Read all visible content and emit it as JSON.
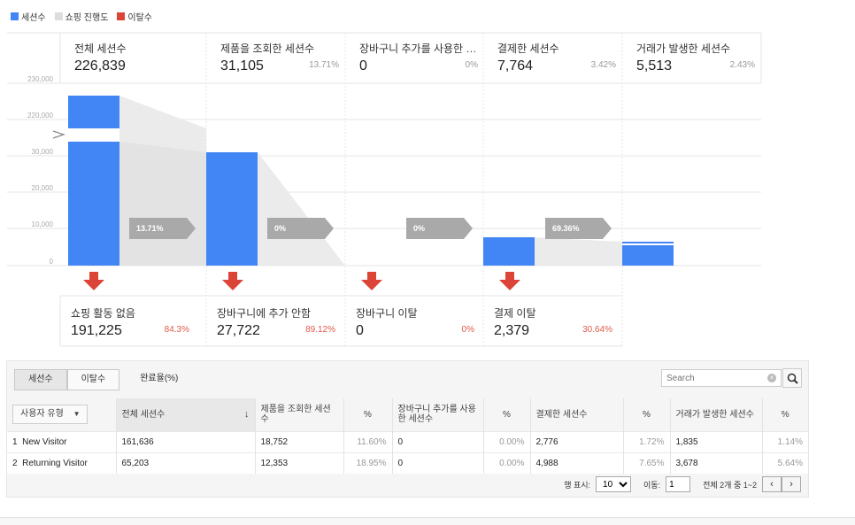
{
  "legend": [
    {
      "label": "세션수",
      "color": "#4285f4"
    },
    {
      "label": "쇼핑 진행도",
      "color": "#dddddd"
    },
    {
      "label": "이탈수",
      "color": "#db4437"
    }
  ],
  "y_ticks": [
    "230,000",
    "220,000",
    "30,000",
    "20,000",
    "10,000",
    "0"
  ],
  "stages": [
    {
      "label": "전체 세션수",
      "value": "226,839",
      "pct": "",
      "progress": "13.71%",
      "drop_label": "쇼핑 활동 없음",
      "drop_value": "191,225",
      "drop_pct": "84.3%"
    },
    {
      "label": "제품을 조회한 세션수",
      "value": "31,105",
      "pct": "13.71%",
      "progress": "0%",
      "drop_label": "장바구니에 추가 안함",
      "drop_value": "27,722",
      "drop_pct": "89.12%"
    },
    {
      "label": "장바구니 추가를 사용한 세...",
      "value": "0",
      "pct": "0%",
      "progress": "0%",
      "drop_label": "장바구니 이탈",
      "drop_value": "0",
      "drop_pct": "0%"
    },
    {
      "label": "결제한 세션수",
      "value": "7,764",
      "pct": "3.42%",
      "progress": "69.36%",
      "drop_label": "결제 이탈",
      "drop_value": "2,379",
      "drop_pct": "30.64%"
    },
    {
      "label": "거래가 발생한 세션수",
      "value": "5,513",
      "pct": "2.43%"
    }
  ],
  "tabs": {
    "sessions": "세선수",
    "exits": "이탈수",
    "completion": "완료율(%)"
  },
  "search": {
    "placeholder": "Search"
  },
  "table": {
    "dimension_label": "사용자 유형",
    "headers": [
      "전체 세션수",
      "제품을 조회한 세션수",
      "%",
      "장바구니 추가를 사용한 세션수",
      "%",
      "결제한 세션수",
      "%",
      "거래가 발생한 세션수",
      "%"
    ],
    "rows": [
      {
        "index": "1",
        "name": "New Visitor",
        "cells": [
          "161,636",
          "18,752",
          "11.60%",
          "0",
          "0.00%",
          "2,776",
          "1.72%",
          "1,835",
          "1.14%"
        ]
      },
      {
        "index": "2",
        "name": "Returning Visitor",
        "cells": [
          "65,203",
          "12,353",
          "18.95%",
          "0",
          "0.00%",
          "4,988",
          "7.65%",
          "3,678",
          "5.64%"
        ]
      }
    ]
  },
  "pager": {
    "rows_label": "행 표시:",
    "rows_value": "10",
    "goto_label": "이동:",
    "goto_value": "1",
    "summary": "전체 2개 중 1~2",
    "prev": "‹",
    "next": "›"
  }
}
